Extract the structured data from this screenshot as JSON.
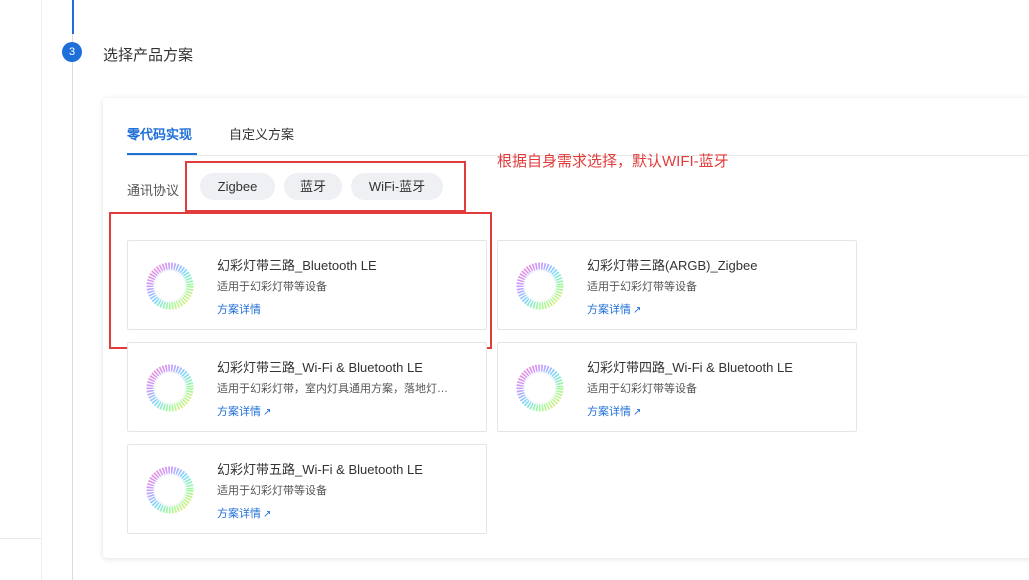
{
  "step": {
    "number": "3",
    "title": "选择产品方案"
  },
  "tabs": [
    {
      "label": "零代码实现",
      "active": true
    },
    {
      "label": "自定义方案",
      "active": false
    }
  ],
  "protocol": {
    "label": "通讯协议",
    "options": [
      "Zigbee",
      "蓝牙",
      "WiFi-蓝牙"
    ]
  },
  "annotation": {
    "text": "根据自身需求选择，默认WIFI-蓝牙",
    "color": "#e23b3b"
  },
  "products": [
    {
      "name": "幻彩灯带三路_Bluetooth LE",
      "desc": "适用于幻彩灯带等设备",
      "link": "方案详情",
      "show_arrow": false
    },
    {
      "name": "幻彩灯带三路(ARGB)_Zigbee",
      "desc": "适用于幻彩灯带等设备",
      "link": "方案详情",
      "show_arrow": true
    },
    {
      "name": "幻彩灯带三路_Wi-Fi & Bluetooth LE",
      "desc": "适用于幻彩灯带，室内灯具通用方案，落地灯…",
      "link": "方案详情",
      "show_arrow": true
    },
    {
      "name": "幻彩灯带四路_Wi-Fi & Bluetooth LE",
      "desc": "适用于幻彩灯带等设备",
      "link": "方案详情",
      "show_arrow": true
    },
    {
      "name": "幻彩灯带五路_Wi-Fi & Bluetooth LE",
      "desc": "适用于幻彩灯带等设备",
      "link": "方案详情",
      "show_arrow": true
    }
  ],
  "colors": {
    "accent": "#1f6fd8",
    "annotation": "#e23b3b"
  },
  "icons": {
    "product": "rainbow-ring-icon",
    "link": "external-arrow-icon"
  }
}
